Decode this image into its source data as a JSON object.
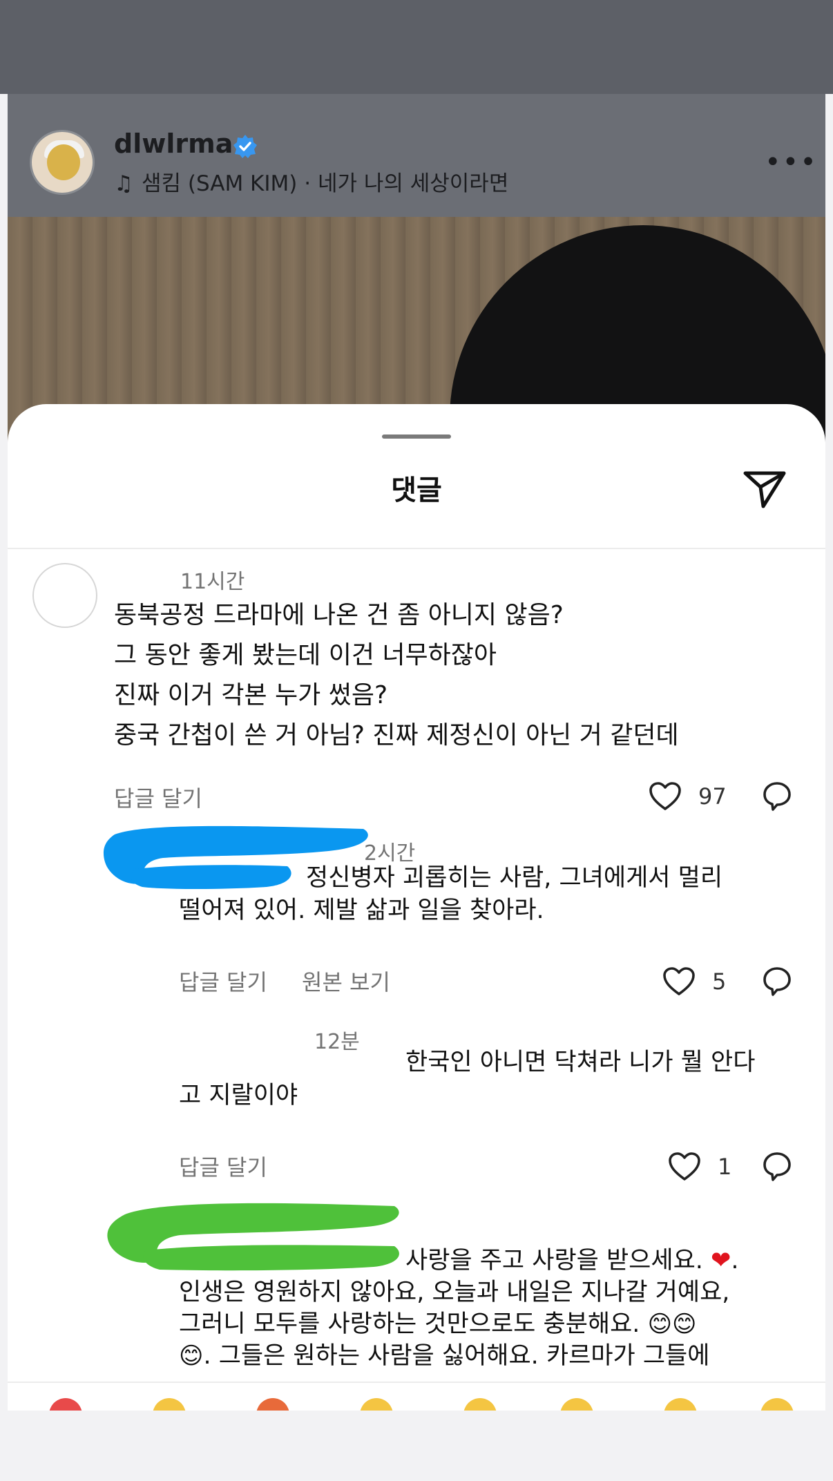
{
  "post": {
    "username": "dlwlrma",
    "music_artist": "샘킴 (SAM KIM)",
    "music_separator": "·",
    "music_title": "네가 나의 세상이라면",
    "more_icon": "more-horizontal-icon"
  },
  "sheet": {
    "title": "댓글",
    "share_icon": "send-icon"
  },
  "comments": [
    {
      "time": "11시간",
      "lines": [
        "동북공정 드라마에 나온 건 좀 아니지 않음?",
        "그 동안 좋게 봤는데 이건 너무하잖아",
        "진짜 이거 각본 누가 썼음?",
        "중국 간첩이 쓴 거 아님? 진짜 제정신이 아닌 거 같던데"
      ],
      "reply_label": "답글 달기",
      "likes": "97"
    },
    {
      "time": "2시간",
      "lines": [
        "정신병자 괴롭히는 사람, 그녀에게서 멀리",
        "떨어져 있어. 제발 삶과 일을 찾아라."
      ],
      "reply_label": "답글 달기",
      "original_label": "원본 보기",
      "likes": "5"
    },
    {
      "time": "12분",
      "lines": [
        "한국인 아니면 닥쳐라 니가 뭘 안다",
        "고 지랄이야"
      ],
      "reply_label": "답글 달기",
      "likes": "1"
    },
    {
      "lines": [
        "사랑을 주고 사랑을 받으세요.",
        ".",
        "인생은 영원하지 않아요, 오늘과 내일은 지나갈 거예요,",
        "그러니 모두를 사랑하는 것만으로도 충분해요.",
        ". 그들은 원하는 사람을 싫어해요. 카르마가 그들에"
      ]
    }
  ],
  "colors": {
    "redact_blue": "#0a97f0",
    "redact_green": "#4fc13a",
    "verified": "#3897f0"
  }
}
